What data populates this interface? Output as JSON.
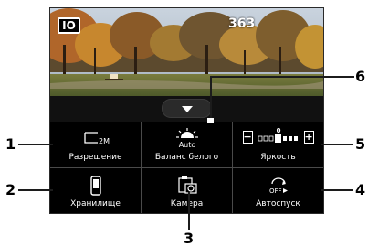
{
  "viewfinder": {
    "mode_badge": "IO",
    "shots_remaining": "363"
  },
  "toggle": {
    "icon": "chevron-down-icon"
  },
  "settings": [
    {
      "label": "Разрешение",
      "icon": "resolution-icon",
      "icon_text": "2M"
    },
    {
      "label": "Баланс белого",
      "icon": "white-balance-icon",
      "icon_text": "Auto"
    },
    {
      "label": "Яркость",
      "icon": "brightness-icon",
      "icon_text": "0"
    },
    {
      "label": "Хранилище",
      "icon": "storage-icon"
    },
    {
      "label": "Камера",
      "icon": "camera-icon"
    },
    {
      "label": "Автоспуск",
      "icon": "self-timer-icon",
      "icon_text": "OFF"
    }
  ],
  "brightness": {
    "minus": "−",
    "plus": "+"
  },
  "callouts": [
    "1",
    "2",
    "3",
    "4",
    "5",
    "6"
  ],
  "colors": {
    "background": "#000000",
    "text": "#ffffff",
    "divider": "#4a4a4a",
    "callout": "#000000"
  }
}
